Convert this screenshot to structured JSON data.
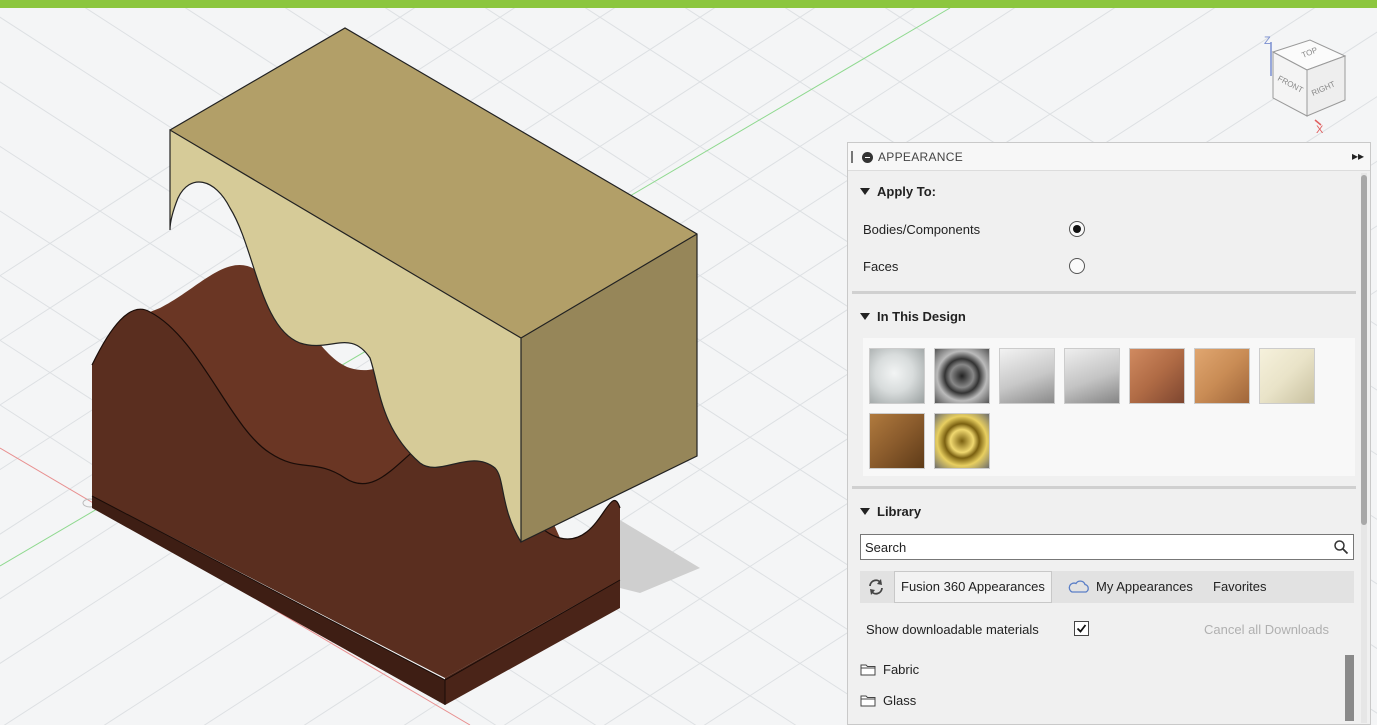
{
  "colors": {
    "accent_bar": "#8cc63e",
    "block_body": "#c9bd86",
    "base_body": "#5a2e1f"
  },
  "viewcube": {
    "axis_z": "Z",
    "axis_x": "X",
    "face_top": "TOP",
    "face_front": "FRONT",
    "face_right": "RIGHT"
  },
  "panel": {
    "title": "APPEARANCE",
    "icons": {
      "collapse": "minus-circle-icon",
      "expand": "double-chevron-right-icon"
    },
    "apply_to": {
      "title": "Apply To:",
      "options": [
        {
          "label": "Bodies/Components",
          "selected": true
        },
        {
          "label": "Faces",
          "selected": false
        }
      ]
    },
    "in_this_design": {
      "title": "In This Design",
      "swatches": [
        {
          "name": "glass-clear-swatch",
          "color": "#d8dcdc"
        },
        {
          "name": "metal-chrome-swatch",
          "color": "#6f6f6f"
        },
        {
          "name": "plastic-gray-swatch-1",
          "color": "#c8c8c8"
        },
        {
          "name": "plastic-gray-swatch-2",
          "color": "#c4c4c4"
        },
        {
          "name": "wood-cherry-swatch",
          "color": "#b06b45"
        },
        {
          "name": "wood-oak-swatch",
          "color": "#c98c55"
        },
        {
          "name": "paint-cream-swatch",
          "color": "#e9e3c8"
        },
        {
          "name": "wood-pine-swatch",
          "color": "#8a5b2c"
        },
        {
          "name": "metal-gold-swatch",
          "color": "#b89c3a"
        }
      ]
    },
    "library": {
      "title": "Library",
      "search_placeholder": "Search",
      "tabs": [
        "Fusion 360 Appearances",
        "My Appearances",
        "Favorites"
      ],
      "active_tab": "Fusion 360 Appearances",
      "show_downloadable_label": "Show downloadable materials",
      "show_downloadable_checked": true,
      "cancel_downloads_label": "Cancel all Downloads",
      "folders": [
        "Fabric",
        "Glass"
      ]
    }
  }
}
